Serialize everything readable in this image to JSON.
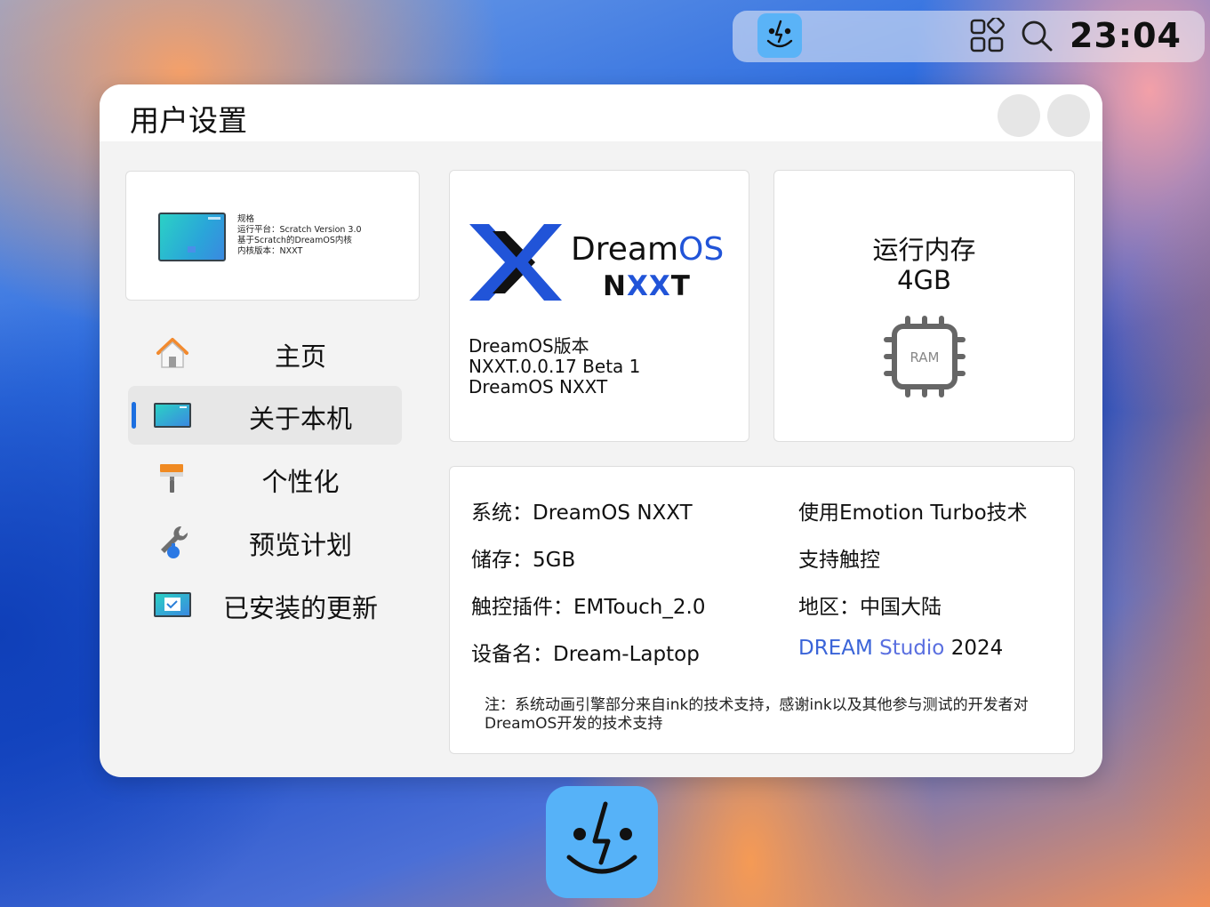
{
  "topbar": {
    "finder_icon": "finder-face-icon",
    "apps_icon": "apps-grid-icon",
    "search_icon": "search-icon",
    "clock": "23:04"
  },
  "window": {
    "title": "用户设置",
    "controls": [
      "minimize-button",
      "close-button"
    ]
  },
  "summary_card": {
    "lines": [
      "规格",
      "运行平台：Scratch Version 3.0",
      "基于Scratch的DreamOS内核",
      "内核版本：NXXT"
    ]
  },
  "sidebar": {
    "items": [
      {
        "label": "主页",
        "icon": "home-icon",
        "active": false
      },
      {
        "label": "关于本机",
        "icon": "device-icon",
        "active": true
      },
      {
        "label": "个性化",
        "icon": "paintbrush-icon",
        "active": false
      },
      {
        "label": "预览计划",
        "icon": "wrench-icon",
        "active": false
      },
      {
        "label": "已安装的更新",
        "icon": "update-icon",
        "active": false
      }
    ]
  },
  "logo_card": {
    "brand_dream": "Dream",
    "brand_os": "OS",
    "product_n": "N",
    "product_xx": "XX",
    "product_t": "T",
    "version_lines": [
      "DreamOS版本",
      "NXXT.0.0.17 Beta 1",
      "DreamOS NXXT"
    ]
  },
  "ram_card": {
    "title": "运行内存",
    "value": "4GB",
    "chip_label": "RAM"
  },
  "info_card": {
    "left": [
      "系统：DreamOS NXXT",
      "储存：5GB",
      "触控插件：EMTouch_2.0",
      "设备名：Dream-Laptop"
    ],
    "right": [
      "使用Emotion Turbo技术",
      "支持触控",
      "地区：中国大陆"
    ],
    "brand_dream": "DREAM",
    "brand_studio": "Studio",
    "brand_year": "2024",
    "note": "注：系统动画引擎部分来自ink的技术支持，感谢ink以及其他参与测试的开发者对DreamOS开发的技术支持"
  },
  "dock": {
    "finder_icon": "finder-face-icon"
  },
  "colors": {
    "accent": "#1c6fe0",
    "logo_blue": "#2154d8",
    "finder_blue": "#56b2f8"
  }
}
